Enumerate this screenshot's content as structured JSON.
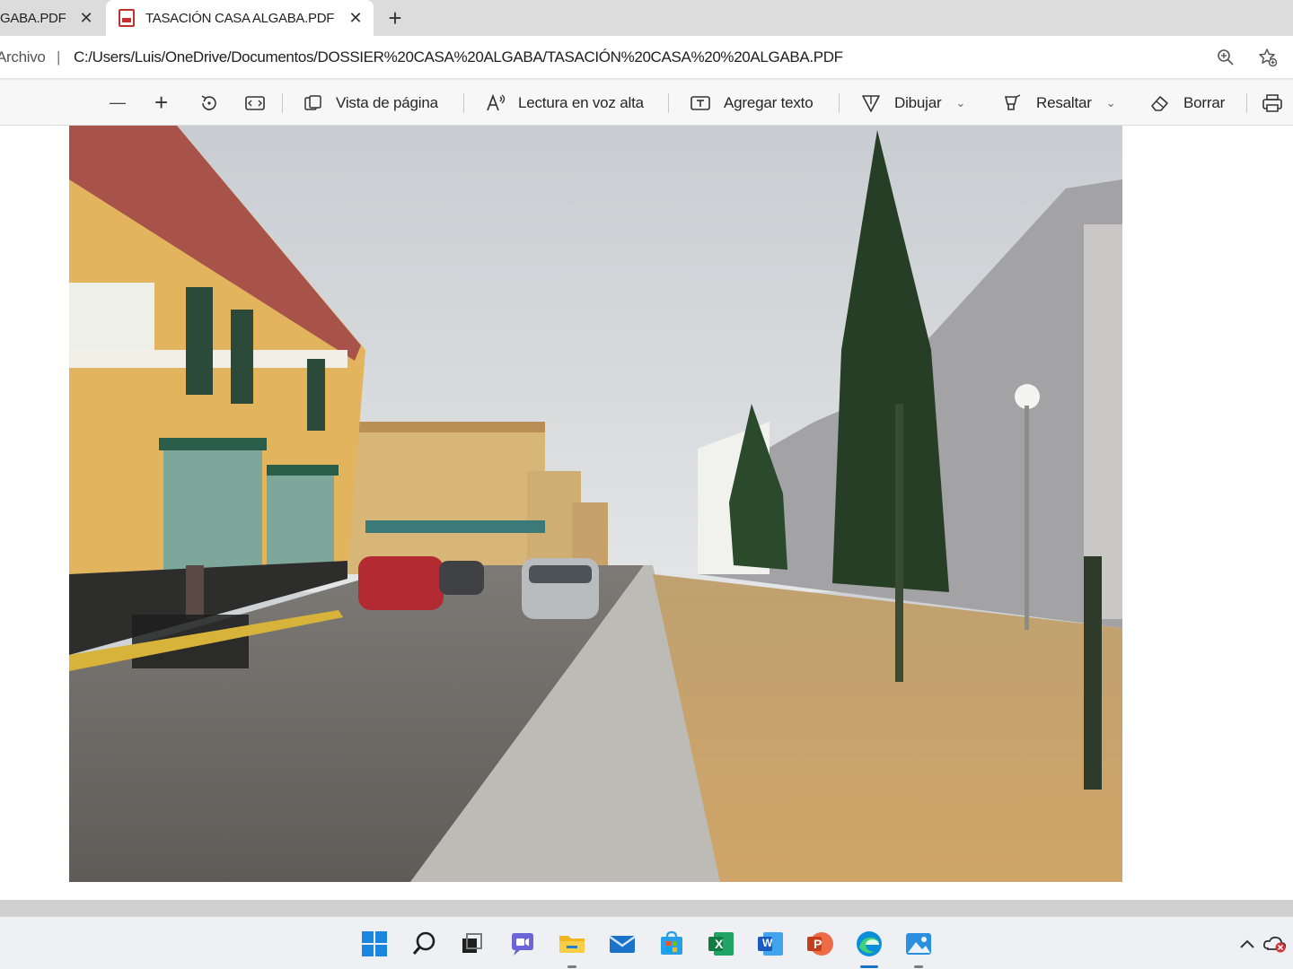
{
  "tabs": [
    {
      "label": "GABA.PDF",
      "close": "✕",
      "active": false
    },
    {
      "label": "TASACIÓN CASA ALGABA.PDF",
      "close": "✕",
      "active": true
    }
  ],
  "new_tab": "+",
  "address": {
    "scheme": "Archivo",
    "divider": "|",
    "url": "C:/Users/Luis/OneDrive/Documentos/DOSSIER%20CASA%20ALGABA/TASACIÓN%20CASA%20%20ALGABA.PDF"
  },
  "toolbar": {
    "zoom_out": "—",
    "zoom_in": "+",
    "page_view": "Vista de página",
    "read_aloud": "Lectura en voz alta",
    "add_text": "Agregar texto",
    "draw": "Dibujar",
    "highlight": "Resaltar",
    "erase": "Borrar"
  },
  "photo": {
    "subject": "street-photo"
  },
  "taskbar": {
    "icons": [
      "windows-start-icon",
      "search-icon",
      "task-view-icon",
      "teams-chat-icon",
      "file-explorer-icon",
      "mail-icon",
      "store-icon",
      "excel-icon",
      "word-icon",
      "powerpoint-icon",
      "edge-icon",
      "photos-icon"
    ],
    "excel_letter": "X",
    "word_letter": "W",
    "powerpoint_letter": "P"
  },
  "colors": {
    "accent": "#1a73c9",
    "pdf_red": "#c4302b"
  }
}
